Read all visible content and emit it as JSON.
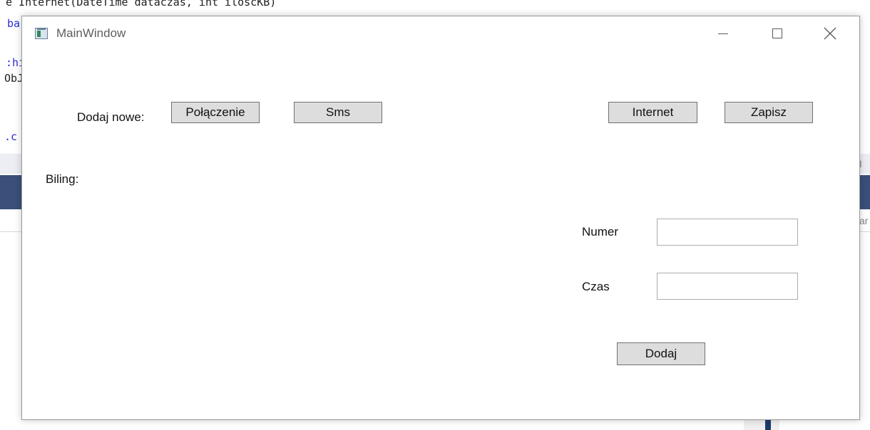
{
  "window": {
    "title": "MainWindow",
    "caption_buttons": [
      "minimize-icon",
      "maximize-icon",
      "close-icon"
    ]
  },
  "toolbar": {
    "add_new_label": "Dodaj nowe:",
    "connection_button": "Połączenie",
    "sms_button": "Sms",
    "internet_button": "Internet",
    "save_button": "Zapisz"
  },
  "billing": {
    "label": "Biling:"
  },
  "form": {
    "number_label": "Numer",
    "number_value": "",
    "time_label": "Czas",
    "time_value": "",
    "add_button": "Dodaj"
  },
  "background_code": {
    "line1": "e Internet(DateTime dataczas, int iloscKB)",
    "line2": "ba",
    "line3": ":hi",
    "line4": "ObJ",
    "line5": ".c",
    "right_scrap1": "I",
    "right_scrap2": "ar"
  }
}
